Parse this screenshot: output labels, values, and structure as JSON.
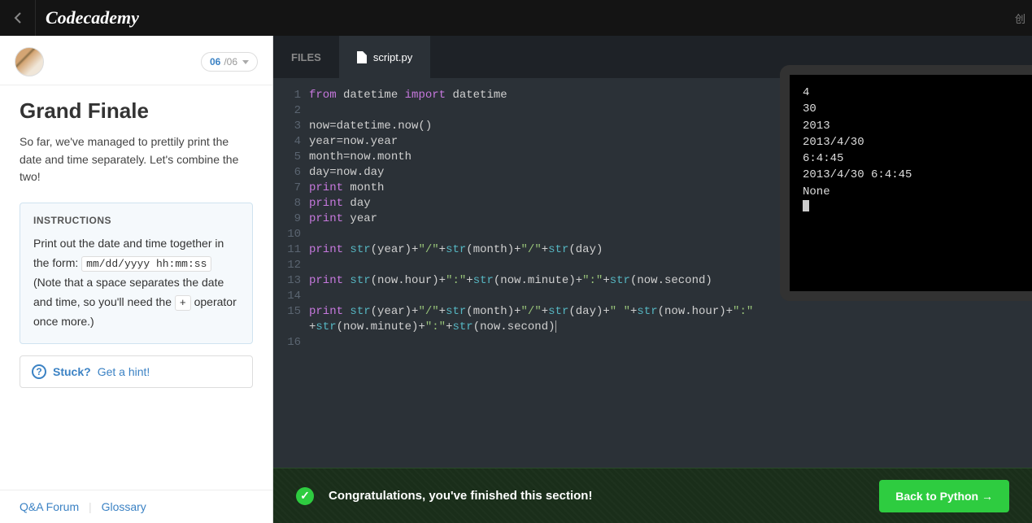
{
  "header": {
    "logo": "Codecademy",
    "right_text": "创"
  },
  "sidebar": {
    "lesson_current": "06",
    "lesson_total": "/06",
    "title": "Grand Finale",
    "description": "So far, we've managed to prettily print the date and time separately. Let's combine the two!",
    "instructions_heading": "INSTRUCTIONS",
    "instructions_p1": "Print out the date and time together in the form: ",
    "instructions_code1": "mm/dd/yyyy hh:mm:ss",
    "instructions_p2": " (Note that a space separates the date and time, so you'll need the ",
    "instructions_code2": "+",
    "instructions_p3": " operator once more.)",
    "hint_stuck": "Stuck?",
    "hint_get": "Get a hint!",
    "footer_qa": "Q&A Forum",
    "footer_glossary": "Glossary"
  },
  "editor": {
    "files_label": "FILES",
    "file_name": "script.py",
    "gutter": [
      "1",
      "2",
      "3",
      "4",
      "5",
      "6",
      "7",
      "8",
      "9",
      "10",
      "11",
      "12",
      "13",
      "14",
      "15",
      "",
      "16"
    ],
    "code": [
      {
        "segments": [
          {
            "t": "from ",
            "c": "kw-from"
          },
          {
            "t": "datetime ",
            "c": "ident"
          },
          {
            "t": "import ",
            "c": "kw-import"
          },
          {
            "t": "datetime",
            "c": "ident"
          }
        ]
      },
      {
        "segments": []
      },
      {
        "segments": [
          {
            "t": "now=datetime.now()",
            "c": "ident"
          }
        ]
      },
      {
        "segments": [
          {
            "t": "year=now.year",
            "c": "ident"
          }
        ]
      },
      {
        "segments": [
          {
            "t": "month=now.month",
            "c": "ident"
          }
        ]
      },
      {
        "segments": [
          {
            "t": "day=now.day",
            "c": "ident"
          }
        ]
      },
      {
        "segments": [
          {
            "t": "print ",
            "c": "kw-print"
          },
          {
            "t": "month",
            "c": "ident"
          }
        ]
      },
      {
        "segments": [
          {
            "t": "print ",
            "c": "kw-print"
          },
          {
            "t": "day",
            "c": "ident"
          }
        ]
      },
      {
        "segments": [
          {
            "t": "print ",
            "c": "kw-print"
          },
          {
            "t": "year",
            "c": "ident"
          }
        ]
      },
      {
        "segments": []
      },
      {
        "segments": [
          {
            "t": "print ",
            "c": "kw-print"
          },
          {
            "t": "str",
            "c": "func"
          },
          {
            "t": "(year)+",
            "c": "ident"
          },
          {
            "t": "\"/\"",
            "c": "str"
          },
          {
            "t": "+",
            "c": "ident"
          },
          {
            "t": "str",
            "c": "func"
          },
          {
            "t": "(month)+",
            "c": "ident"
          },
          {
            "t": "\"/\"",
            "c": "str"
          },
          {
            "t": "+",
            "c": "ident"
          },
          {
            "t": "str",
            "c": "func"
          },
          {
            "t": "(day)",
            "c": "ident"
          }
        ]
      },
      {
        "segments": []
      },
      {
        "segments": [
          {
            "t": "print ",
            "c": "kw-print"
          },
          {
            "t": "str",
            "c": "func"
          },
          {
            "t": "(now.hour)+",
            "c": "ident"
          },
          {
            "t": "\":\"",
            "c": "str"
          },
          {
            "t": "+",
            "c": "ident"
          },
          {
            "t": "str",
            "c": "func"
          },
          {
            "t": "(now.minute)+",
            "c": "ident"
          },
          {
            "t": "\":\"",
            "c": "str"
          },
          {
            "t": "+",
            "c": "ident"
          },
          {
            "t": "str",
            "c": "func"
          },
          {
            "t": "(now.second)",
            "c": "ident"
          }
        ]
      },
      {
        "segments": []
      },
      {
        "segments": [
          {
            "t": "print ",
            "c": "kw-print"
          },
          {
            "t": "str",
            "c": "func"
          },
          {
            "t": "(year)+",
            "c": "ident"
          },
          {
            "t": "\"/\"",
            "c": "str"
          },
          {
            "t": "+",
            "c": "ident"
          },
          {
            "t": "str",
            "c": "func"
          },
          {
            "t": "(month)+",
            "c": "ident"
          },
          {
            "t": "\"/\"",
            "c": "str"
          },
          {
            "t": "+",
            "c": "ident"
          },
          {
            "t": "str",
            "c": "func"
          },
          {
            "t": "(day)+",
            "c": "ident"
          },
          {
            "t": "\" \"",
            "c": "str"
          },
          {
            "t": "+",
            "c": "ident"
          },
          {
            "t": "str",
            "c": "func"
          },
          {
            "t": "(now.hour)+",
            "c": "ident"
          },
          {
            "t": "\":\"",
            "c": "str"
          }
        ]
      },
      {
        "segments": [
          {
            "t": "+",
            "c": "ident"
          },
          {
            "t": "str",
            "c": "func"
          },
          {
            "t": "(now.minute)+",
            "c": "ident"
          },
          {
            "t": "\":\"",
            "c": "str"
          },
          {
            "t": "+",
            "c": "ident"
          },
          {
            "t": "str",
            "c": "func"
          },
          {
            "t": "(now.second)",
            "c": "ident"
          }
        ]
      },
      {
        "segments": []
      }
    ]
  },
  "console": {
    "lines": [
      "4",
      "30",
      "2013",
      "2013/4/30",
      "6:4:45",
      "2013/4/30 6:4:45",
      "None"
    ]
  },
  "bottom": {
    "message": "Congratulations, you've finished this section!",
    "button": "Back to Python →"
  }
}
